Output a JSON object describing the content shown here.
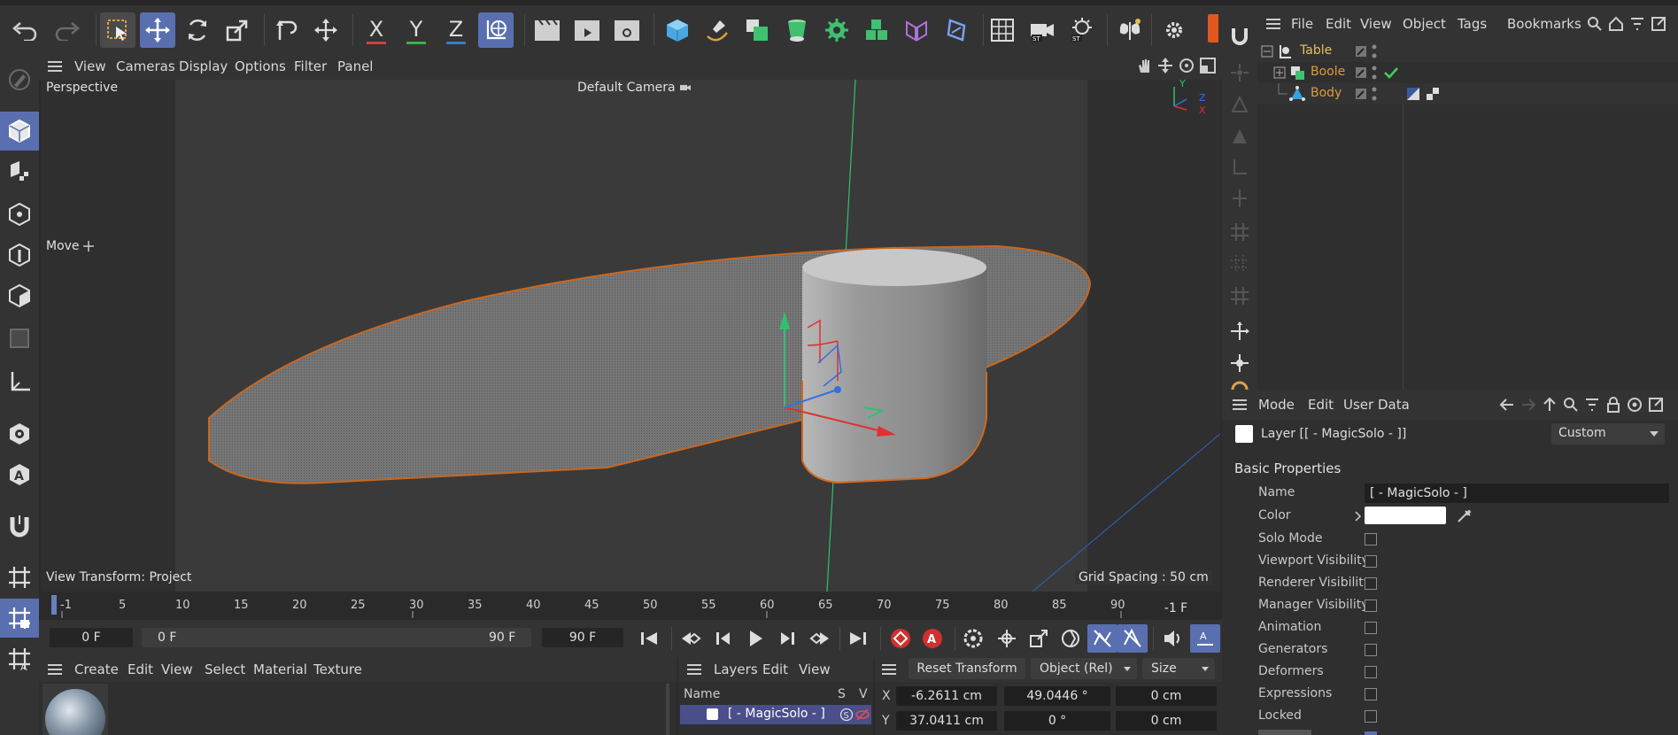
{
  "viewport": {
    "menu": [
      "View",
      "Cameras",
      "Display",
      "Options",
      "Filter",
      "Panel"
    ],
    "projection": "Perspective",
    "camera": "Default Camera",
    "tool_label": "Move",
    "view_transform": "View Transform: Project",
    "grid_spacing": "Grid Spacing : 50 cm",
    "axis_y": "Y",
    "axis_z": "Z",
    "axis_x": "X"
  },
  "toolbar": {
    "x_label": "X",
    "y_label": "Y",
    "z_label": "Z"
  },
  "object_manager": {
    "menu": [
      "File",
      "Edit",
      "View",
      "Object",
      "Tags",
      "Bookmarks"
    ],
    "objects": [
      {
        "name": "Table",
        "color": "#e8c25a"
      },
      {
        "name": "Boole",
        "color": "#e09a3a"
      },
      {
        "name": "Body",
        "color": "#e09a3a"
      }
    ]
  },
  "attribute_manager": {
    "menu": [
      "Mode",
      "Edit",
      "User Data"
    ],
    "layer_title": "Layer [[ - MagicSolo - ]]",
    "preset": "Custom",
    "section": "Basic Properties",
    "name_label": "Name",
    "name_value": "[ - MagicSolo - ]",
    "color_label": "Color",
    "props": [
      "Solo Mode",
      "Viewport Visibility",
      "Renderer Visibility",
      "Manager Visibility",
      "Animation",
      "Generators",
      "Deformers",
      "Expressions",
      "Locked"
    ]
  },
  "timeline": {
    "ticks": [
      "-1",
      "5",
      "10",
      "15",
      "20",
      "25",
      "30",
      "35",
      "40",
      "45",
      "50",
      "55",
      "60",
      "65",
      "70",
      "75",
      "80",
      "85",
      "90"
    ],
    "current_frame_display": "-1 F",
    "start_field": "0 F",
    "range_start": "0 F",
    "range_end": "90 F",
    "end_field": "90 F"
  },
  "material_manager": {
    "menu": [
      "Create",
      "Edit",
      "View",
      "Select",
      "Material",
      "Texture"
    ]
  },
  "layer_manager": {
    "menu": [
      "Layers",
      "Edit",
      "View"
    ],
    "col_name": "Name",
    "col_s": "S",
    "col_v": "V",
    "layer_name": "[ - MagicSolo - ]"
  },
  "coordinates": {
    "reset_label": "Reset Transform",
    "mode": "Object (Rel)",
    "size_mode": "Size",
    "rows": [
      {
        "axis": "X",
        "pos": "-6.2611 cm",
        "rot": "49.0446 °",
        "size": "0 cm"
      },
      {
        "axis": "Y",
        "pos": "37.0411 cm",
        "rot": "0 °",
        "size": "0 cm"
      }
    ]
  }
}
